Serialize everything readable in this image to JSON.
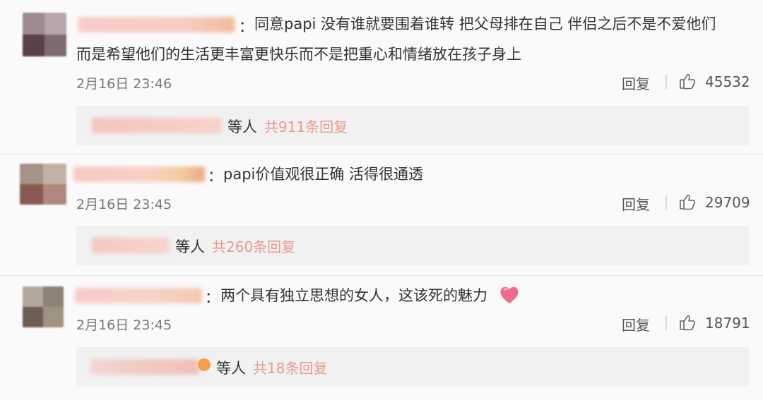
{
  "comments": [
    {
      "text_line1": "同意papi 没有谁就要围着谁转 把父母排在自己 伴侣之后不是不爱他们",
      "text_line2": "而是希望他们的生活更丰富更快乐而不是把重心和情绪放在孩子身上",
      "time": "2月16日 23:46",
      "reply_label": "回复",
      "likes": "45532",
      "reply_people": "等人",
      "reply_count": "共911条回复"
    },
    {
      "text_line1": "papi价值观很正确 活得很通透",
      "time": "2月16日 23:45",
      "reply_label": "回复",
      "likes": "29709",
      "reply_people": "等人",
      "reply_count": "共260条回复"
    },
    {
      "text_line1": "两个具有独立思想的女人，这该死的魅力",
      "time": "2月16日 23:45",
      "reply_label": "回复",
      "likes": "18791",
      "reply_people": "等人",
      "reply_count": "共18条回复"
    }
  ],
  "colors": {
    "reply_count": "#e89a8f",
    "name_blur": "#f3b9a8",
    "heart": "#f06a8a"
  },
  "icons": {
    "like": "thumbs-up-icon",
    "heart": "heart-emoji-icon"
  }
}
